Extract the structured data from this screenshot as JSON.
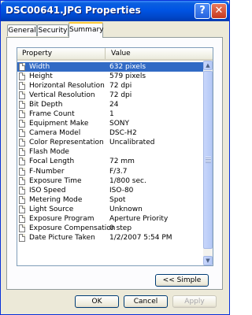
{
  "window": {
    "title": "DSC00641.JPG Properties",
    "help_glyph": "?",
    "close_glyph": "✕"
  },
  "tabs": [
    {
      "label": "General"
    },
    {
      "label": "Security"
    },
    {
      "label": "Summary"
    }
  ],
  "listview": {
    "columns": {
      "property": "Property",
      "value": "Value"
    },
    "rows": [
      {
        "property": "Width",
        "value": "632 pixels"
      },
      {
        "property": "Height",
        "value": "579 pixels"
      },
      {
        "property": "Horizontal Resolution",
        "value": "72 dpi"
      },
      {
        "property": "Vertical Resolution",
        "value": "72 dpi"
      },
      {
        "property": "Bit Depth",
        "value": "24"
      },
      {
        "property": "Frame Count",
        "value": "1"
      },
      {
        "property": "Equipment Make",
        "value": "SONY"
      },
      {
        "property": "Camera Model",
        "value": "DSC-H2"
      },
      {
        "property": "Color Representation",
        "value": "Uncalibrated"
      },
      {
        "property": "Flash Mode",
        "value": ""
      },
      {
        "property": "Focal Length",
        "value": "72 mm"
      },
      {
        "property": "F-Number",
        "value": "F/3.7"
      },
      {
        "property": "Exposure Time",
        "value": "1/800 sec."
      },
      {
        "property": "ISO Speed",
        "value": "ISO-80"
      },
      {
        "property": "Metering Mode",
        "value": "Spot"
      },
      {
        "property": "Light Source",
        "value": "Unknown"
      },
      {
        "property": "Exposure Program",
        "value": "Aperture Priority"
      },
      {
        "property": "Exposure Compensation",
        "value": "0 step"
      },
      {
        "property": "Date Picture Taken",
        "value": "1/2/2007 5:54 PM"
      }
    ],
    "selected_row": "Width"
  },
  "buttons": {
    "simple": "<< Simple",
    "ok": "OK",
    "cancel": "Cancel",
    "apply": "Apply"
  }
}
